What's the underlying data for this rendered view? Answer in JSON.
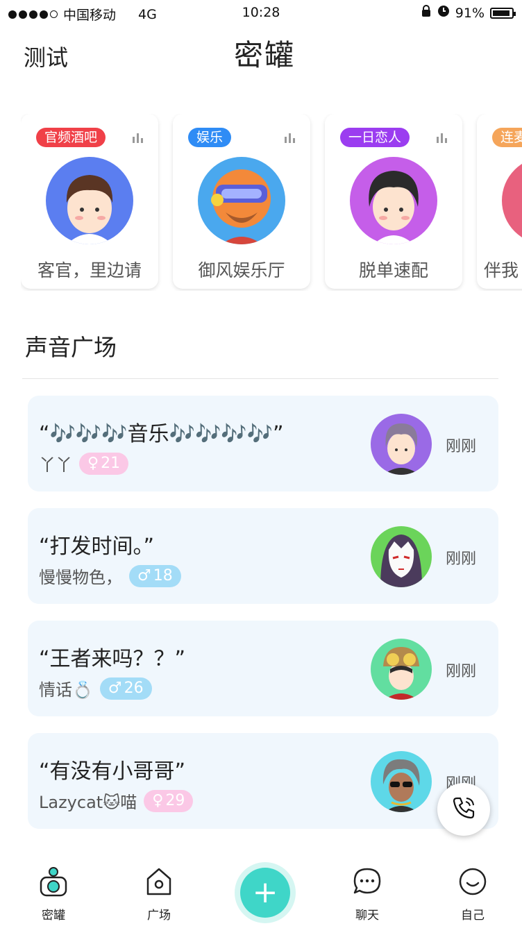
{
  "status_bar": {
    "carrier": "中国移动",
    "network": "4G",
    "time": "10:28",
    "battery": "91%",
    "battery_level": 0.91
  },
  "header": {
    "left_label": "测试",
    "title": "密罐"
  },
  "rooms": [
    {
      "tag": "官频酒吧",
      "tag_color": "#f04048",
      "name": "客官，里边请"
    },
    {
      "tag": "娱乐",
      "tag_color": "#2f8cf5",
      "name": "御风娱乐厅"
    },
    {
      "tag": "一日恋人",
      "tag_color": "#9b3df0",
      "name": "脱单速配"
    },
    {
      "tag": "连麦",
      "tag_color": "#f5a55a",
      "name": "伴我"
    }
  ],
  "section": {
    "title": "声音广场"
  },
  "posts": [
    {
      "title": "“🎶🎶🎶音乐🎶🎶🎶🎶”",
      "user": "丫丫",
      "gender": "♀",
      "age": "21",
      "time": "刚刚"
    },
    {
      "title": "“打发时间。”",
      "user": "慢慢物色，",
      "gender": "♂",
      "age": "18",
      "time": "刚刚"
    },
    {
      "title": "“王者来吗？？”",
      "user": "情话💍",
      "gender": "♂",
      "age": "26",
      "time": "刚刚"
    },
    {
      "title": "“有没有小哥哥”",
      "user": "Lazycat🐱喵",
      "gender": "♀",
      "age": "29",
      "time": "刚刚"
    }
  ],
  "tabs": {
    "home": "密罐",
    "square": "广场",
    "add": "+",
    "chat": "聊天",
    "me": "自己"
  },
  "colors": {
    "accent": "#3fd6c8",
    "card_bg": "#f0f7fd",
    "female_badge": "#fbc8e6",
    "male_badge": "#a3dcf7"
  }
}
